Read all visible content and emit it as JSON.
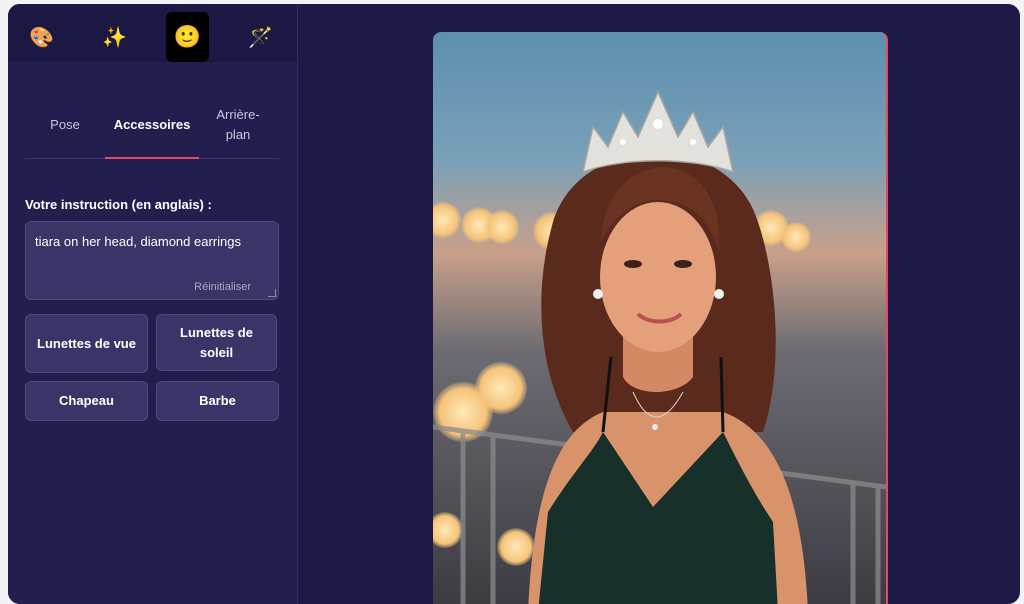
{
  "toolbar": {
    "tools": [
      {
        "icon": "palette-icon",
        "glyph": "🎨"
      },
      {
        "icon": "sparkles-icon",
        "glyph": "✨"
      },
      {
        "icon": "smiley-icon",
        "glyph": "🙂"
      },
      {
        "icon": "magic-wand-icon",
        "glyph": "🪄"
      }
    ]
  },
  "tabs": [
    "Pose",
    "Accessoires",
    "Arrière-plan"
  ],
  "instruction": {
    "label": "Votre instruction (en anglais) :",
    "value": "tiara on her head, diamond earrings",
    "reset": "Réinitialiser"
  },
  "presets": [
    "Lunettes de vue",
    "Lunettes de soleil",
    "Chapeau",
    "Barbe"
  ],
  "colors": {
    "accent": "#e8476a",
    "panel": "#221e4e",
    "background": "#1d1a45"
  }
}
